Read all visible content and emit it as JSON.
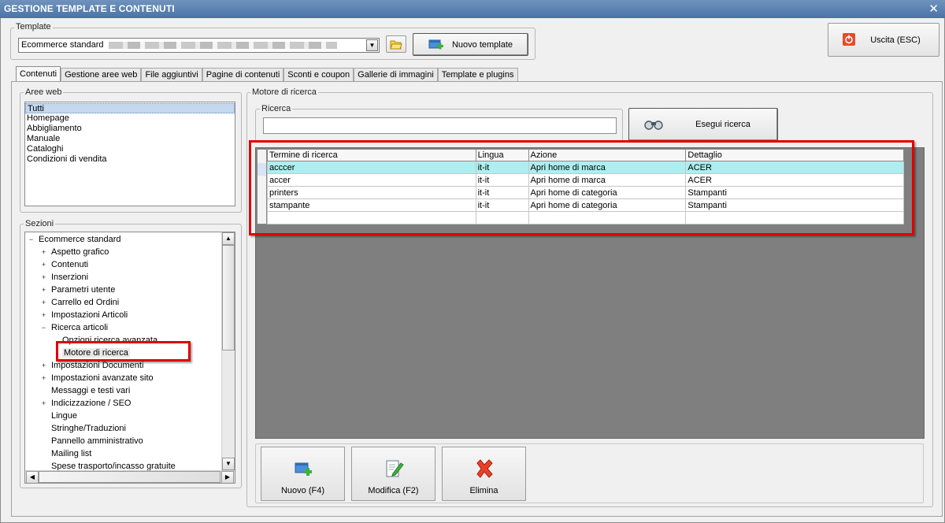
{
  "window": {
    "title": "GESTIONE TEMPLATE E CONTENUTI",
    "close_symbol": "✕"
  },
  "template": {
    "legend": "Template",
    "selected": "Ecommerce standard",
    "new_template_label": "Nuovo template"
  },
  "exit_button": {
    "label": "Uscita (ESC)"
  },
  "tabs": [
    {
      "label": "Contenuti"
    },
    {
      "label": "Gestione aree web"
    },
    {
      "label": "File aggiuntivi"
    },
    {
      "label": "Pagine di contenuti"
    },
    {
      "label": "Sconti e coupon"
    },
    {
      "label": "Gallerie di immagini"
    },
    {
      "label": "Template e plugins"
    }
  ],
  "aree_web": {
    "legend": "Aree web",
    "items": [
      "Tutti",
      "Homepage",
      "Abbigliamento",
      "Manuale",
      "Cataloghi",
      "Condizioni di vendita"
    ]
  },
  "sezioni": {
    "legend": "Sezioni",
    "root": "Ecommerce standard",
    "items": [
      {
        "label": "Aspetto grafico",
        "exp": "+"
      },
      {
        "label": "Contenuti",
        "exp": "+"
      },
      {
        "label": "Inserzioni",
        "exp": "+"
      },
      {
        "label": "Parametri utente",
        "exp": "+"
      },
      {
        "label": "Carrello ed Ordini",
        "exp": "+"
      },
      {
        "label": "Impostazioni Articoli",
        "exp": "+"
      },
      {
        "label": "Ricerca articoli",
        "exp": "−"
      },
      {
        "label": "Opzioni ricerca avanzata",
        "exp": ""
      },
      {
        "label": "Motore di ricerca",
        "exp": ""
      },
      {
        "label": "Impostazioni Documenti",
        "exp": "+"
      },
      {
        "label": "Impostazioni avanzate sito",
        "exp": "+"
      },
      {
        "label": "Messaggi e testi vari",
        "exp": ""
      },
      {
        "label": "Indicizzazione / SEO",
        "exp": "+"
      },
      {
        "label": "Lingue",
        "exp": ""
      },
      {
        "label": "Stringhe/Traduzioni",
        "exp": ""
      },
      {
        "label": "Pannello amministrativo",
        "exp": ""
      },
      {
        "label": "Mailing list",
        "exp": ""
      },
      {
        "label": "Spese trasporto/incasso gratuite",
        "exp": ""
      }
    ]
  },
  "motore": {
    "legend": "Motore di ricerca",
    "ricerca_legend": "Ricerca",
    "search_value": "",
    "search_button": "Esegui ricerca"
  },
  "grid": {
    "columns": [
      "Termine di ricerca",
      "Lingua",
      "Azione",
      "Dettaglio"
    ],
    "rows": [
      [
        "acccer",
        "it-it",
        "Apri home di marca",
        "ACER"
      ],
      [
        "accer",
        "it-it",
        "Apri home di marca",
        "ACER"
      ],
      [
        "printers",
        "it-it",
        "Apri home di categoria",
        "Stampanti"
      ],
      [
        "stampante",
        "it-it",
        "Apri home di categoria",
        "Stampanti"
      ]
    ]
  },
  "actions": {
    "new": "Nuovo (F4)",
    "edit": "Modifica (F2)",
    "delete": "Elimina"
  },
  "colors": {
    "title_bar": "#4a73a5",
    "highlight_row": "#aeeef0",
    "annotation_red": "#e00000"
  }
}
